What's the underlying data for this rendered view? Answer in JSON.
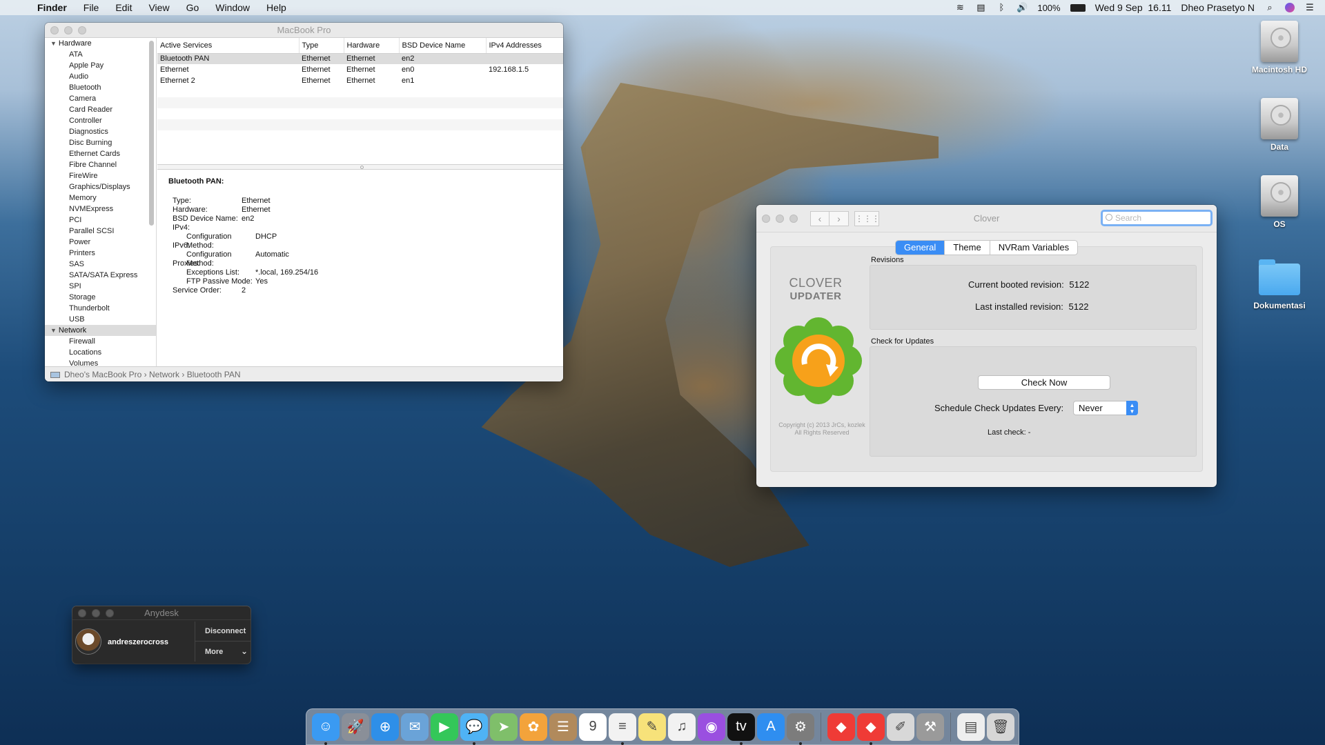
{
  "menubar": {
    "app_name": "Finder",
    "menus": [
      "File",
      "Edit",
      "View",
      "Go",
      "Window",
      "Help"
    ],
    "battery": "100%",
    "datetime": "Wed 9 Sep  16.11",
    "user": "Dheo Prasetyo N"
  },
  "sysinfo": {
    "title": "MacBook Pro",
    "sidebar": {
      "hardware_label": "Hardware",
      "hardware_items": [
        "ATA",
        "Apple Pay",
        "Audio",
        "Bluetooth",
        "Camera",
        "Card Reader",
        "Controller",
        "Diagnostics",
        "Disc Burning",
        "Ethernet Cards",
        "Fibre Channel",
        "FireWire",
        "Graphics/Displays",
        "Memory",
        "NVMExpress",
        "PCI",
        "Parallel SCSI",
        "Power",
        "Printers",
        "SAS",
        "SATA/SATA Express",
        "SPI",
        "Storage",
        "Thunderbolt",
        "USB"
      ],
      "network_label": "Network",
      "network_items": [
        "Firewall",
        "Locations",
        "Volumes"
      ]
    },
    "table": {
      "headers": [
        "Active Services",
        "Type",
        "Hardware",
        "BSD Device Name",
        "IPv4 Addresses"
      ],
      "rows": [
        [
          "Bluetooth PAN",
          "Ethernet",
          "Ethernet",
          "en2",
          ""
        ],
        [
          "Ethernet",
          "Ethernet",
          "Ethernet",
          "en0",
          "192.168.1.5"
        ],
        [
          "Ethernet 2",
          "Ethernet",
          "Ethernet",
          "en1",
          ""
        ]
      ]
    },
    "detail": {
      "title": "Bluetooth PAN:",
      "rows": [
        {
          "k": "Type:",
          "v": "Ethernet",
          "indent": 0
        },
        {
          "k": "Hardware:",
          "v": "Ethernet",
          "indent": 0
        },
        {
          "k": "BSD Device Name:",
          "v": "en2",
          "indent": 0
        },
        {
          "k": "IPv4:",
          "v": "",
          "indent": 0
        },
        {
          "k": "Configuration Method:",
          "v": "DHCP",
          "indent": 1
        },
        {
          "k": "IPv6:",
          "v": "",
          "indent": 0
        },
        {
          "k": "Configuration Method:",
          "v": "Automatic",
          "indent": 1
        },
        {
          "k": "Proxies:",
          "v": "",
          "indent": 0
        },
        {
          "k": "Exceptions List:",
          "v": "*.local, 169.254/16",
          "indent": 1
        },
        {
          "k": "FTP Passive Mode:",
          "v": "Yes",
          "indent": 1
        },
        {
          "k": "Service Order:",
          "v": "2",
          "indent": 0
        }
      ]
    },
    "path": [
      "Dheo's MacBook Pro",
      "Network",
      "Bluetooth PAN"
    ]
  },
  "clover": {
    "title": "Clover",
    "search_placeholder": "Search",
    "tabs": [
      "General",
      "Theme",
      "NVRam Variables"
    ],
    "active_tab": "General",
    "logo_line1": "CLOVER",
    "logo_line2": "UPDATER",
    "copyright": "Copyright (c) 2013 JrCs, kozlek\nAll Rights Reserved",
    "revisions_label": "Revisions",
    "current_booted_label": "Current booted revision:",
    "current_booted_value": "5122",
    "last_installed_label": "Last installed revision:",
    "last_installed_value": "5122",
    "check_updates_label": "Check for Updates",
    "check_now": "Check Now",
    "schedule_label": "Schedule Check Updates Every:",
    "schedule_value": "Never",
    "last_check": "Last check: -"
  },
  "anydesk": {
    "title": "Anydesk",
    "user": "andreszerocross",
    "disconnect": "Disconnect",
    "more": "More"
  },
  "desktop": {
    "icons": [
      "Macintosh HD",
      "Data",
      "OS",
      "Dokumentasi"
    ]
  },
  "dock": {
    "apps": [
      {
        "name": "finder-icon",
        "color": "#3a9af2",
        "glyph": "☺"
      },
      {
        "name": "launchpad-icon",
        "color": "#8a8f98",
        "glyph": "🚀"
      },
      {
        "name": "safari-icon",
        "color": "#2e8fe8",
        "glyph": "⊕"
      },
      {
        "name": "mail-icon",
        "color": "#6aa3d8",
        "glyph": "✉"
      },
      {
        "name": "facetime-icon",
        "color": "#34c759",
        "glyph": "▶"
      },
      {
        "name": "messages-icon",
        "color": "#4fb3f5",
        "glyph": "💬"
      },
      {
        "name": "maps-icon",
        "color": "#7fbf6a",
        "glyph": "➤"
      },
      {
        "name": "photos-icon",
        "color": "#f3a33b",
        "glyph": "✿"
      },
      {
        "name": "contacts-icon",
        "color": "#b18a5c",
        "glyph": "☰"
      },
      {
        "name": "calendar-icon",
        "color": "#ffffff",
        "glyph": "9"
      },
      {
        "name": "reminders-icon",
        "color": "#f2f2f2",
        "glyph": "≡"
      },
      {
        "name": "notes-icon",
        "color": "#f7e27a",
        "glyph": "✎"
      },
      {
        "name": "music-icon",
        "color": "#f2f2f2",
        "glyph": "♫"
      },
      {
        "name": "podcasts-icon",
        "color": "#9a4fe0",
        "glyph": "◉"
      },
      {
        "name": "tv-icon",
        "color": "#111111",
        "glyph": "tv"
      },
      {
        "name": "app-store-icon",
        "color": "#2f8ef0",
        "glyph": "A"
      },
      {
        "name": "system-preferences-icon",
        "color": "#7c7c7c",
        "glyph": "⚙"
      },
      {
        "name": "anydesk-icon",
        "color": "#ef3b36",
        "glyph": "◆"
      },
      {
        "name": "anydesk-alt-icon",
        "color": "#ef3b36",
        "glyph": "◆"
      },
      {
        "name": "script-editor-icon",
        "color": "#d8d8d8",
        "glyph": "✐"
      },
      {
        "name": "automator-icon",
        "color": "#9a9a9a",
        "glyph": "⚒"
      },
      {
        "name": "documents-stack-icon",
        "color": "#eeeeee",
        "glyph": "▤"
      },
      {
        "name": "trash-icon",
        "color": "#d6d6d6",
        "glyph": "🗑"
      }
    ]
  }
}
